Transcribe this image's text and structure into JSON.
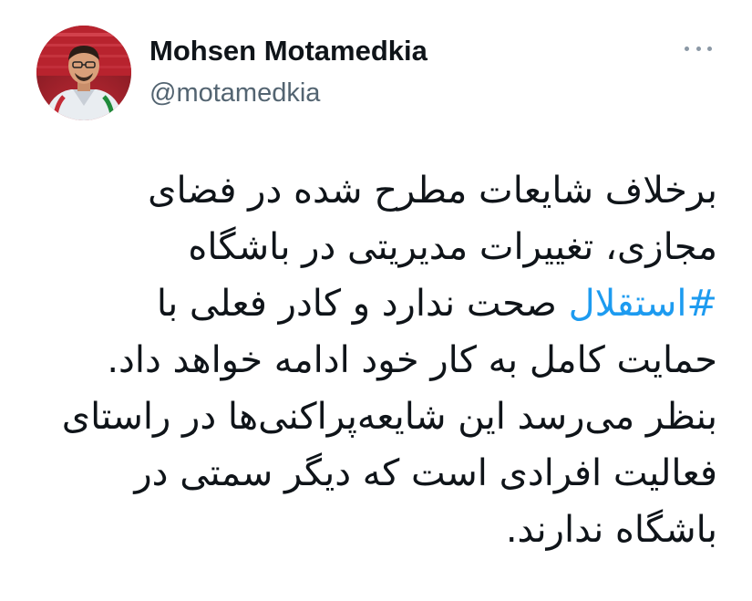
{
  "author": {
    "name": "Mohsen Motamedkia",
    "handle": "@motamedkia"
  },
  "icons": {
    "more": "more-options-icon",
    "avatar": "profile-photo"
  },
  "colors": {
    "text": "#0f1419",
    "secondary": "#536471",
    "link": "#1d9bf0"
  },
  "tweet": {
    "line1": "برخلاف شایعات مطرح شده در فضای",
    "line2": "مجازی، تغییرات مدیریتی در باشگاه",
    "line3_hashtag": "#استقلال",
    "line3_rest": " صحت ندارد و کادر فعلی با",
    "line4": "حمایت کامل به کار خود ادامه خواهد داد.",
    "line5": "بنظر می‌رسد این شایعه‌پراکنی‌ها در راستای",
    "line6": "فعالیت افرادی است که دیگر سمتی در",
    "line7": "باشگاه ندارند."
  }
}
